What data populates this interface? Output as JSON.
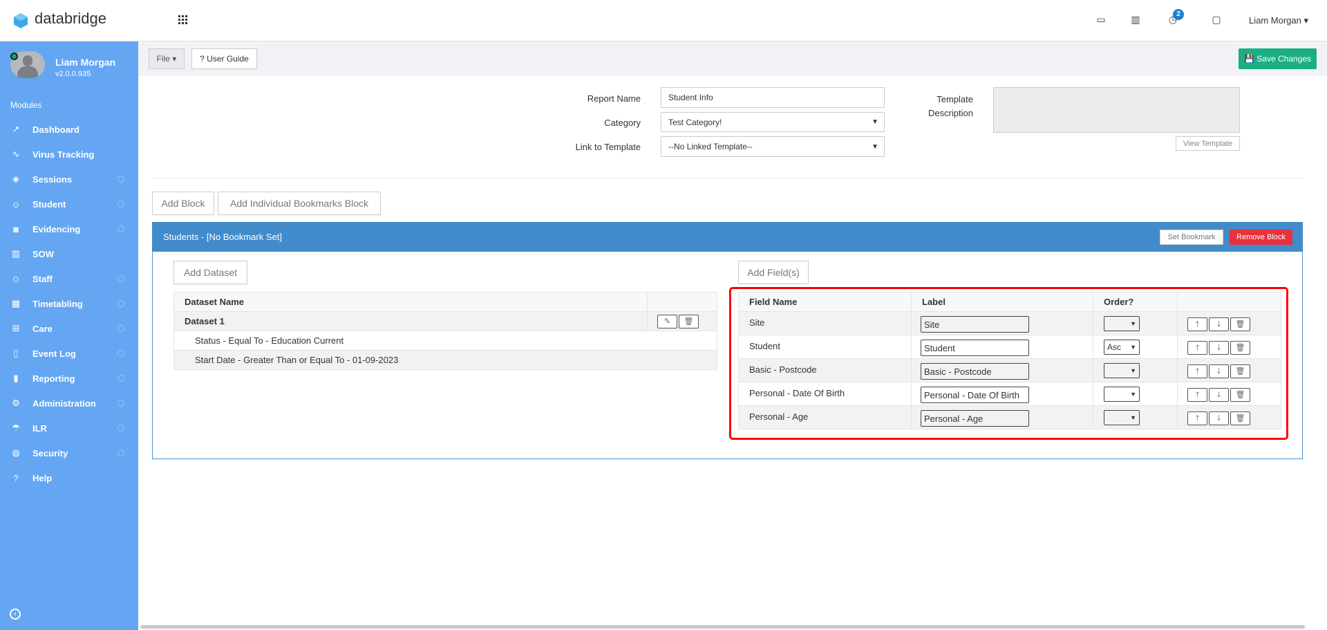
{
  "app": {
    "name": "databridge",
    "user": "Liam Morgan",
    "notification_count": "2"
  },
  "profile": {
    "name": "Liam Morgan",
    "version": "v2.0.0.935"
  },
  "sidebar": {
    "section": "Modules",
    "items": [
      {
        "label": "Dashboard",
        "icon": "chart-line-icon",
        "glyph": "↗",
        "dot": false
      },
      {
        "label": "Virus Tracking",
        "icon": "pulse-icon",
        "glyph": "∿",
        "dot": false
      },
      {
        "label": "Sessions",
        "icon": "layers-icon",
        "glyph": "◈",
        "dot": true
      },
      {
        "label": "Student",
        "icon": "users-icon",
        "glyph": "☺",
        "dot": true
      },
      {
        "label": "Evidencing",
        "icon": "camera-icon",
        "glyph": "◙",
        "dot": true
      },
      {
        "label": "SOW",
        "icon": "book-icon",
        "glyph": "▥",
        "dot": false
      },
      {
        "label": "Staff",
        "icon": "users-icon",
        "glyph": "☺",
        "dot": true
      },
      {
        "label": "Timetabling",
        "icon": "calendar-icon",
        "glyph": "▦",
        "dot": true
      },
      {
        "label": "Care",
        "icon": "care-icon",
        "glyph": "⊞",
        "dot": true
      },
      {
        "label": "Event Log",
        "icon": "clipboard-icon",
        "glyph": "▯",
        "dot": true
      },
      {
        "label": "Reporting",
        "icon": "bar-chart-icon",
        "glyph": "▮",
        "dot": true
      },
      {
        "label": "Administration",
        "icon": "gear-icon",
        "glyph": "⚙",
        "dot": true
      },
      {
        "label": "ILR",
        "icon": "umbrella-icon",
        "glyph": "☂",
        "dot": true
      },
      {
        "label": "Security",
        "icon": "globe-icon",
        "glyph": "◍",
        "dot": true
      },
      {
        "label": "Help",
        "icon": "help-icon",
        "glyph": "?",
        "dot": false
      }
    ]
  },
  "toolbar": {
    "file": "File ▾",
    "user_guide": "? User Guide",
    "save": "💾 Save Changes"
  },
  "form": {
    "report_name_label": "Report Name",
    "report_name": "Student Info",
    "category_label": "Category",
    "category": "Test Category!",
    "link_label": "Link to Template",
    "link": "--No Linked Template--",
    "template_desc_label_1": "Template",
    "template_desc_label_2": "Description",
    "view_template": "View Template"
  },
  "blocks": {
    "add_block": "Add Block",
    "add_bookmarks_block": "Add Individual Bookmarks Block"
  },
  "block": {
    "title": "Students - [No Bookmark Set]",
    "set_bookmark": "Set Bookmark",
    "remove_block": "Remove Block",
    "add_dataset": "Add Dataset",
    "add_fields": "Add Field(s)",
    "dataset_header": "Dataset Name",
    "dataset_name": "Dataset 1",
    "filters": [
      "Status - Equal To - Education Current",
      "Start Date - Greater Than or Equal To - 01-09-2023"
    ],
    "field_headers": [
      "Field Name",
      "Label",
      "Order?"
    ],
    "fields": [
      {
        "name": "Site",
        "label": "Site",
        "order": ""
      },
      {
        "name": "Student",
        "label": "Student",
        "order": "Asc"
      },
      {
        "name": "Basic - Postcode",
        "label": "Basic - Postcode",
        "order": ""
      },
      {
        "name": "Personal - Date Of Birth",
        "label": "Personal - Date Of Birth",
        "order": ""
      },
      {
        "name": "Personal - Age",
        "label": "Personal - Age",
        "order": ""
      }
    ]
  },
  "colors": {
    "sidebar": "#64a6f2",
    "panel": "#428bca",
    "save": "#1bae83",
    "remove": "#e5323e",
    "highlight": "#ff0000"
  }
}
